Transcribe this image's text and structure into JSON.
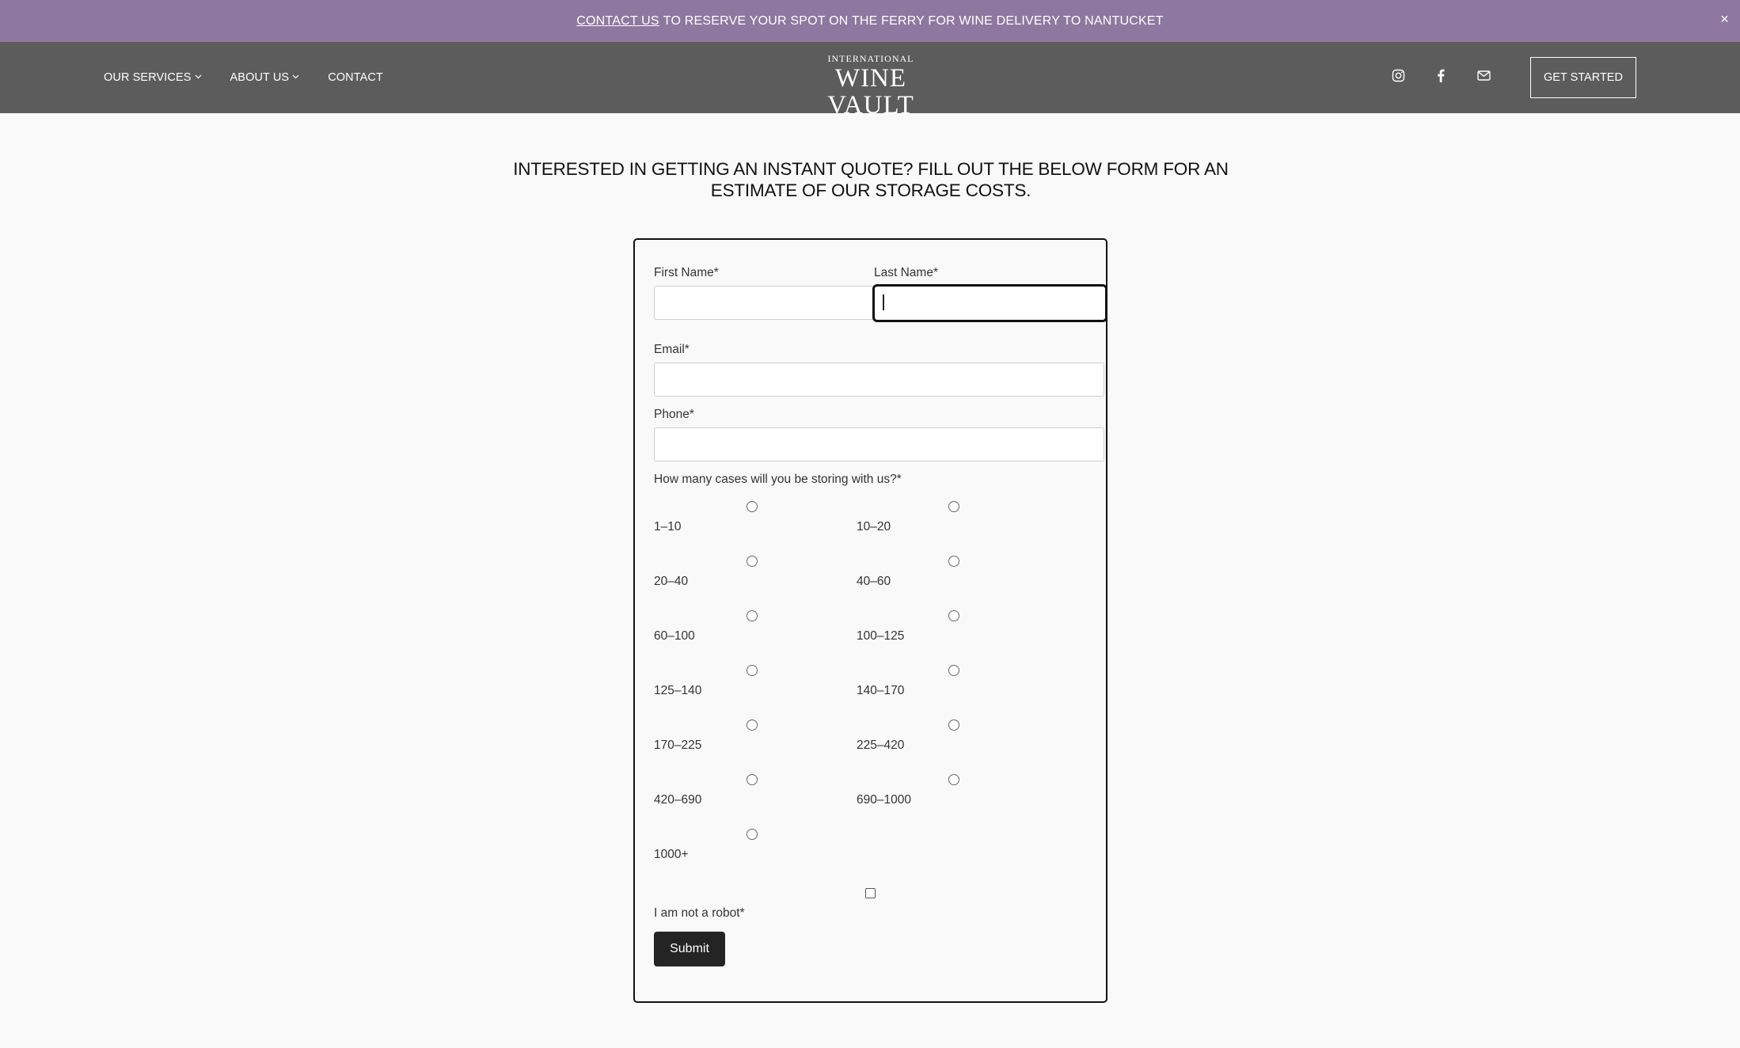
{
  "announcement": {
    "link_text": "CONTACT US",
    "text": "TO RESERVE YOUR SPOT ON THE FERRY FOR WINE DELIVERY TO NANTUCKET",
    "close": "×"
  },
  "nav": {
    "items": [
      {
        "label": "OUR SERVICES",
        "has_dropdown": true
      },
      {
        "label": "ABOUT US",
        "has_dropdown": true
      },
      {
        "label": "CONTACT",
        "has_dropdown": false
      }
    ]
  },
  "logo": {
    "top_line": "INTERNATIONAL",
    "main": "WINE VAULT"
  },
  "socials": [
    "instagram-icon",
    "facebook-icon",
    "mail-icon"
  ],
  "header_cta": "GET STARTED",
  "headline": "INTERESTED IN GETTING AN INSTANT QUOTE? FILL OUT THE BELOW FORM FOR AN ESTIMATE OF OUR STORAGE COSTS.",
  "form": {
    "first_name_label": "First Name*",
    "last_name_label": "Last Name*",
    "email_label": "Email*",
    "phone_label": "Phone*",
    "cases_label": "How many cases will you be storing with us?*",
    "case_options": [
      "1–10",
      "10–20",
      "20–40",
      "40–60",
      "60–100",
      "100–125",
      "125–140",
      "140–170",
      "170–225",
      "225–420",
      "420–690",
      "690–1000",
      "1000+"
    ],
    "robot_label": "I am not a robot*",
    "submit": "Submit",
    "first_name_value": "",
    "last_name_value": "",
    "email_value": "",
    "phone_value": ""
  },
  "colors": {
    "announcement_bg": "#8f789f",
    "header_bg": "#5c5c5c",
    "page_bg": "#f9f9f9",
    "button_bg": "#242424"
  }
}
